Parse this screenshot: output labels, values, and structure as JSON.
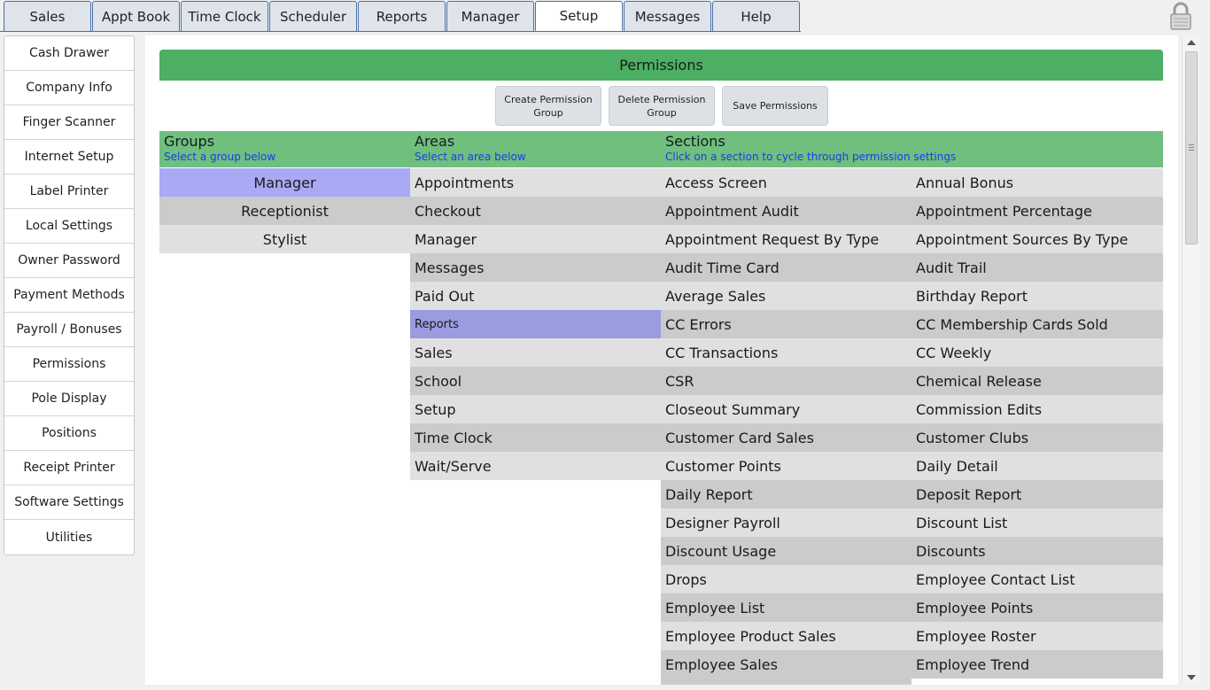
{
  "tabs": [
    "Sales",
    "Appt Book",
    "Time Clock",
    "Scheduler",
    "Reports",
    "Manager",
    "Setup",
    "Messages",
    "Help"
  ],
  "active_tab": "Setup",
  "sidebar": [
    "Cash Drawer",
    "Company Info",
    "Finger Scanner",
    "Internet Setup",
    "Label Printer",
    "Local Settings",
    "Owner Password",
    "Payment Methods",
    "Payroll / Bonuses",
    "Permissions",
    "Pole Display",
    "Positions",
    "Receipt Printer",
    "Software Settings",
    "Utilities"
  ],
  "panel": {
    "title": "Permissions",
    "buttons": [
      "Create Permission Group",
      "Delete Permission Group",
      "Save Permissions"
    ]
  },
  "headers": {
    "groups": {
      "title": "Groups",
      "subtitle": "Select a group below"
    },
    "areas": {
      "title": "Areas",
      "subtitle": "Select an area below"
    },
    "sections": {
      "title": "Sections",
      "subtitle": "Click on a section to cycle through permission settings"
    }
  },
  "groups": [
    "Manager",
    "Receptionist",
    "Stylist"
  ],
  "selected_group": "Manager",
  "areas": [
    "Appointments",
    "Checkout",
    "Manager",
    "Messages",
    "Paid Out",
    "Reports",
    "Sales",
    "School",
    "Setup",
    "Time Clock",
    "Wait/Serve"
  ],
  "selected_area": "Reports",
  "sections_col1": [
    "Access Screen",
    "Appointment Audit",
    "Appointment Request By Type",
    "Audit Time Card",
    "Average Sales",
    "CC Errors",
    "CC Transactions",
    "CSR",
    "Closeout Summary",
    "Customer Card Sales",
    "Customer Points",
    "Daily Report",
    "Designer Payroll",
    "Discount Usage",
    "Drops",
    "Employee List",
    "Employee Product Sales",
    "Employee Sales"
  ],
  "sections_col2": [
    "Annual Bonus",
    "Appointment Percentage",
    "Appointment Sources By Type",
    "Audit Trail",
    "Birthday Report",
    "CC Membership Cards Sold",
    "CC Weekly",
    "Chemical Release",
    "Commission Edits",
    "Customer Clubs",
    "Daily Detail",
    "Deposit Report",
    "Discount List",
    "Discounts",
    "Employee Contact List",
    "Employee Points",
    "Employee Roster",
    "Employee Trend"
  ],
  "colors": {
    "title_green": "#4caf64",
    "header_green": "#6fbf7e",
    "subtitle_blue": "#1a3ee6",
    "selected_group": "#a9a9f5",
    "selected_area": "#9b9bdf"
  },
  "icons": {
    "lock": "padlock-icon"
  }
}
